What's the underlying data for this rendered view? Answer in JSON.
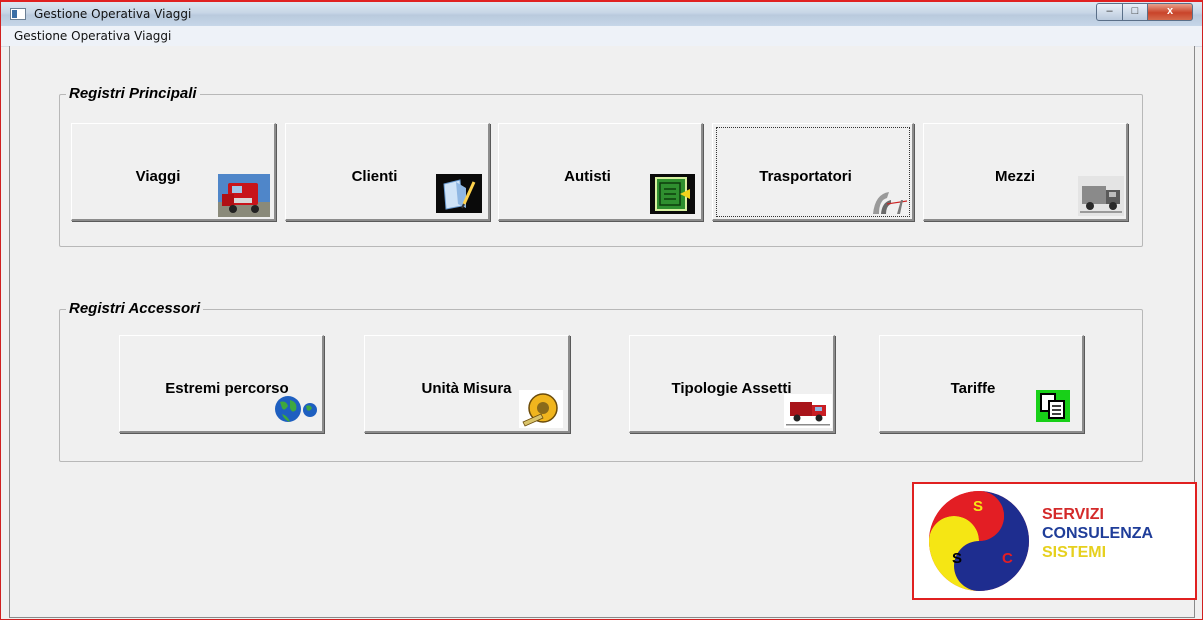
{
  "window": {
    "title": "Gestione Operativa Viaggi",
    "controls": {
      "minimize": "–",
      "maximize": "□",
      "close": "x"
    }
  },
  "menu": {
    "items": [
      "Gestione Operativa Viaggi"
    ]
  },
  "groups": {
    "principali": {
      "label": "Registri Principali",
      "buttons": [
        {
          "label": "Viaggi",
          "icon": "truck-photo-icon"
        },
        {
          "label": "Clienti",
          "icon": "notebook-pen-icon"
        },
        {
          "label": "Autisti",
          "icon": "green-ledger-icon"
        },
        {
          "label": "Trasportatori",
          "icon": "transporter-graphic-icon"
        },
        {
          "label": "Mezzi",
          "icon": "grey-truck-icon"
        }
      ]
    },
    "accessori": {
      "label": "Registri Accessori",
      "buttons": [
        {
          "label": "Estremi percorso",
          "icon": "globe-icon"
        },
        {
          "label": "Unità Misura",
          "icon": "tape-measure-icon"
        },
        {
          "label": "Tipologie Assetti",
          "icon": "red-truck-icon"
        },
        {
          "label": "Tariffe",
          "icon": "copy-documents-icon"
        }
      ]
    }
  },
  "logo": {
    "letters": {
      "top": "S",
      "left": "S",
      "right": "C"
    },
    "lines": [
      "SERVIZI",
      "CONSULENZA",
      "SISTEMI"
    ],
    "colors": {
      "line1": "#d42a2a",
      "line2": "#1f3d99",
      "line3": "#e6d01e",
      "red": "#e31e24",
      "yellow": "#f5e614",
      "blue": "#1e2d8f"
    }
  }
}
